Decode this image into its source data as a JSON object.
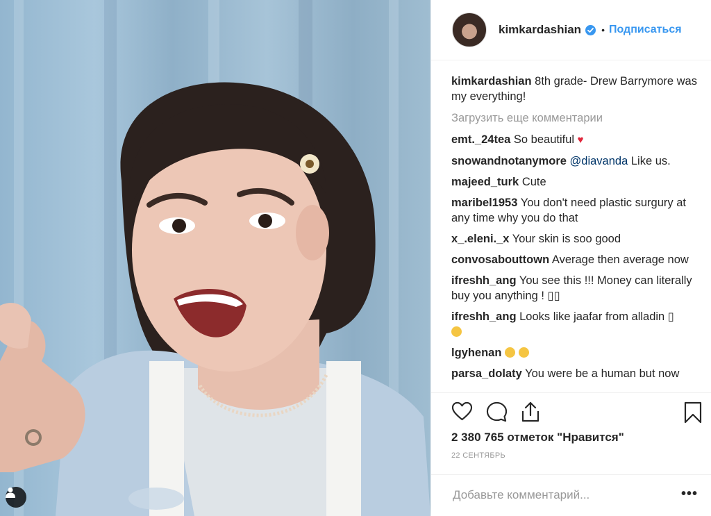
{
  "header": {
    "username": "kimkardashian",
    "separator": "•",
    "follow_label": "Подписаться"
  },
  "caption": {
    "username": "kimkardashian",
    "text": "8th grade- Drew Barrymore was my everything!"
  },
  "load_more_label": "Загрузить еще комментарии",
  "comments": [
    {
      "username": "emt._24tea",
      "text": "So beautiful",
      "suffix": "♥"
    },
    {
      "username": "snowandnotanymore",
      "mention": "@diavanda",
      "text": "Like us."
    },
    {
      "username": "majeed_turk",
      "text": "Cute"
    },
    {
      "username": "maribel1953",
      "text": "You don't need plastic surgury at any time why you do that"
    },
    {
      "username": "x_.eleni._x",
      "text": "Your skin is soo good"
    },
    {
      "username": "convosabouttown",
      "text": "Average then average now"
    },
    {
      "username": "ifreshh_ang",
      "text": "You see this !!! Money can literally buy you anything ! ▯▯"
    },
    {
      "username": "ifreshh_ang",
      "text": "Looks like jaafar from alladin ▯"
    },
    {
      "username": "lgyhenan",
      "text": ""
    },
    {
      "username": "parsa_dolaty",
      "text": "You were be a human but now"
    }
  ],
  "likes_label": "2 380 765 отметок \"Нравится\"",
  "date_label": "22 СЕНТЯБРЬ",
  "add_comment_placeholder": "Добавьте комментарий...",
  "more_label": "•••",
  "colors": {
    "link": "#3897f0",
    "muted": "#999999",
    "text": "#262626",
    "heart": "#e0263b"
  },
  "icons": [
    "heart-icon",
    "comment-icon",
    "share-icon",
    "bookmark-icon",
    "user-tag-icon",
    "verified-badge-icon"
  ]
}
